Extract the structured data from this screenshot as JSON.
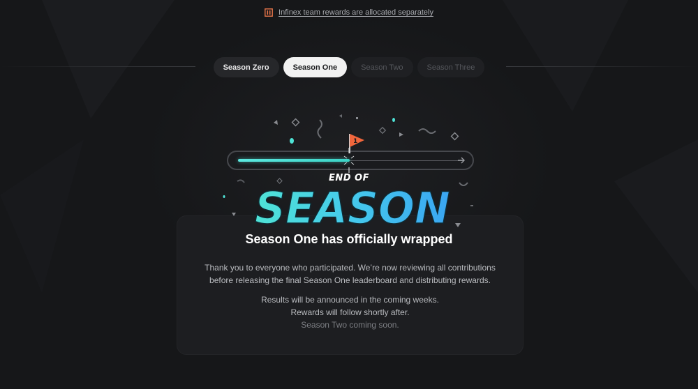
{
  "notice": {
    "icon": "infinex-logo-icon",
    "text": "Infinex team rewards are allocated separately",
    "accent": "#e8764a"
  },
  "tabs": [
    {
      "label": "Season Zero",
      "state": "default"
    },
    {
      "label": "Season One",
      "state": "active"
    },
    {
      "label": "Season Two",
      "state": "disabled"
    },
    {
      "label": "Season Three",
      "state": "disabled"
    }
  ],
  "hero": {
    "eyebrow": "END OF",
    "headline": "SEASON",
    "flag_number": "1",
    "progress": 0.5,
    "colors": {
      "teal": "#4fe3d6",
      "blue": "#3aa6f2",
      "flag": "#f0663c"
    }
  },
  "card": {
    "title": "Season One has officially wrapped",
    "paragraph_1_line_1": "Thank you to everyone who participated. We’re now reviewing all contributions",
    "paragraph_1_line_2": "before releasing the final Season One leaderboard and distributing rewards.",
    "paragraph_2_line_1": "Results will be announced in the coming weeks.",
    "paragraph_2_line_2": "Rewards will follow shortly after.",
    "footer": "Season Two coming soon."
  }
}
